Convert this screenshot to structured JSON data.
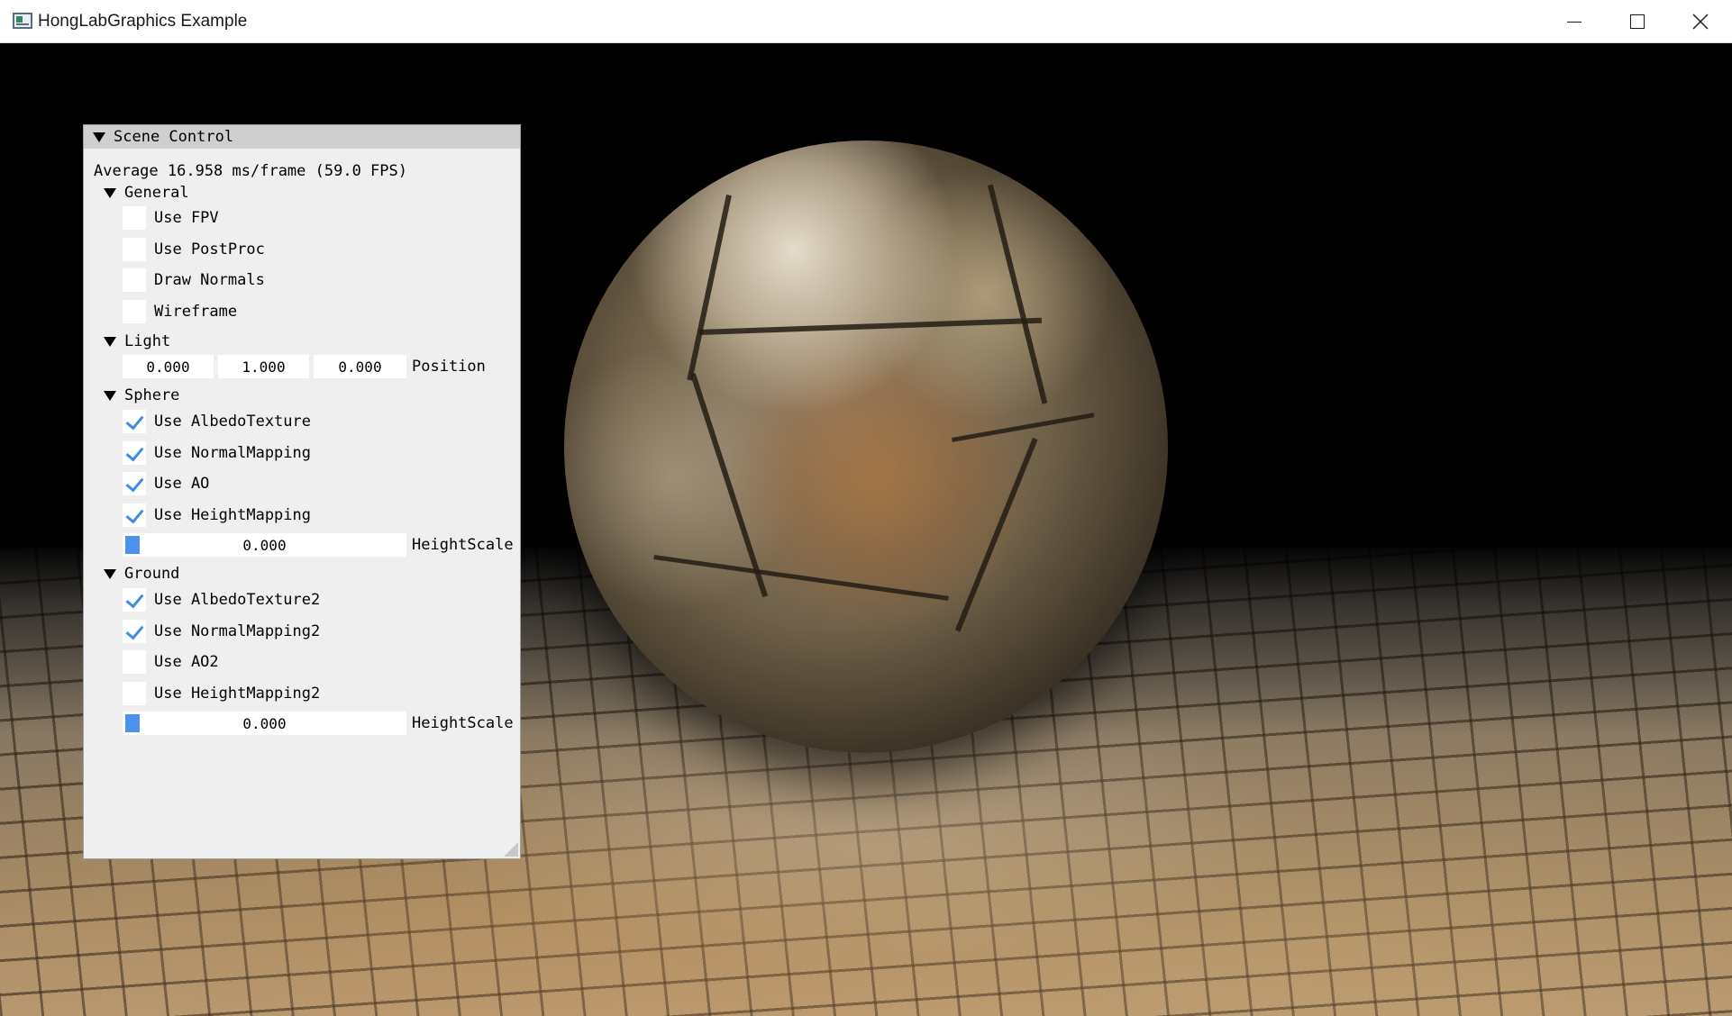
{
  "window": {
    "title": "HongLabGraphics Example",
    "icons": {
      "minimize": "minimize-icon",
      "maximize": "maximize-icon",
      "close": "close-icon"
    }
  },
  "panel": {
    "title": "Scene Control",
    "stats": "Average 16.958 ms/frame (59.0 FPS)",
    "general": {
      "label": "General",
      "items": [
        {
          "label": "Use FPV",
          "checked": false
        },
        {
          "label": "Use PostProc",
          "checked": false
        },
        {
          "label": "Draw Normals",
          "checked": false
        },
        {
          "label": "Wireframe",
          "checked": false
        }
      ]
    },
    "light": {
      "label": "Light",
      "position": {
        "x": "0.000",
        "y": "1.000",
        "z": "0.000",
        "label": "Position"
      }
    },
    "sphere": {
      "label": "Sphere",
      "items": [
        {
          "label": "Use AlbedoTexture",
          "checked": true
        },
        {
          "label": "Use NormalMapping",
          "checked": true
        },
        {
          "label": "Use AO",
          "checked": true
        },
        {
          "label": "Use HeightMapping",
          "checked": true
        }
      ],
      "height_scale": {
        "value": "0.000",
        "label": "HeightScale"
      }
    },
    "ground": {
      "label": "Ground",
      "items": [
        {
          "label": "Use AlbedoTexture2",
          "checked": true
        },
        {
          "label": "Use NormalMapping2",
          "checked": true
        },
        {
          "label": "Use AO2",
          "checked": false
        },
        {
          "label": "Use HeightMapping2",
          "checked": false
        }
      ],
      "height_scale": {
        "value": "0.000",
        "label": "HeightScale"
      }
    }
  },
  "colors": {
    "accent": "#4a92ec",
    "check": "#3d8de6",
    "panel_bg": "#efefef",
    "header_bg": "#cfcfcf"
  }
}
